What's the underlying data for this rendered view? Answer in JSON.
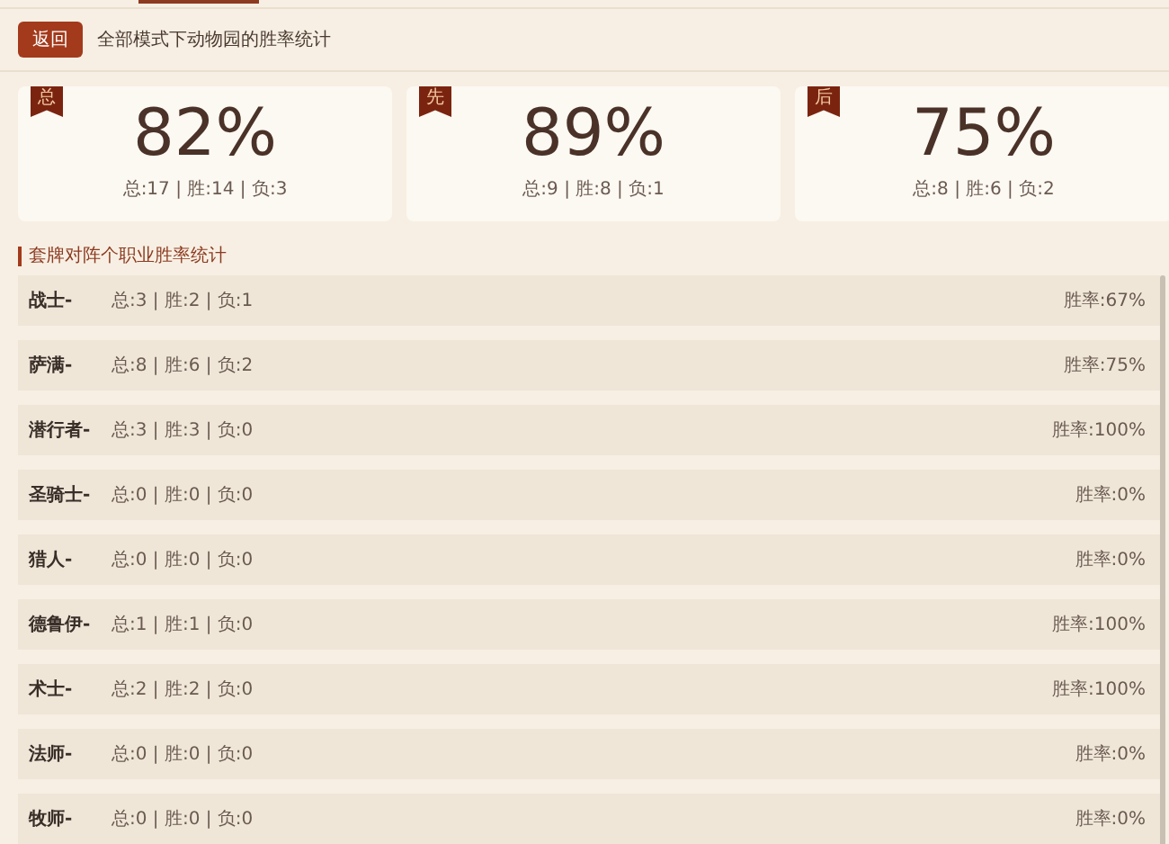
{
  "header": {
    "back_button": "返回",
    "title": "全部模式下动物园的胜率统计"
  },
  "summary_cards": [
    {
      "badge": "总",
      "rate": "82%",
      "detail": "总:17 | 胜:14 | 负:3"
    },
    {
      "badge": "先",
      "rate": "89%",
      "detail": "总:9 | 胜:8 | 负:1"
    },
    {
      "badge": "后",
      "rate": "75%",
      "detail": "总:8 | 胜:6 | 负:2"
    }
  ],
  "section_title": "套牌对阵个职业胜率统计",
  "rows": [
    {
      "class": "战士-",
      "record": "总:3 | 胜:2 | 负:1",
      "win_rate": "胜率:67%"
    },
    {
      "class": "萨满-",
      "record": "总:8 | 胜:6 | 负:2",
      "win_rate": "胜率:75%"
    },
    {
      "class": "潜行者-",
      "record": "总:3 | 胜:3 | 负:0",
      "win_rate": "胜率:100%"
    },
    {
      "class": "圣骑士-",
      "record": "总:0 | 胜:0 | 负:0",
      "win_rate": "胜率:0%"
    },
    {
      "class": "猎人-",
      "record": "总:0 | 胜:0 | 负:0",
      "win_rate": "胜率:0%"
    },
    {
      "class": "德鲁伊-",
      "record": "总:1 | 胜:1 | 负:0",
      "win_rate": "胜率:100%"
    },
    {
      "class": "术士-",
      "record": "总:2 | 胜:2 | 负:0",
      "win_rate": "胜率:100%"
    },
    {
      "class": "法师-",
      "record": "总:0 | 胜:0 | 负:0",
      "win_rate": "胜率:0%"
    },
    {
      "class": "牧师-",
      "record": "总:0 | 胜:0 | 负:0",
      "win_rate": "胜率:0%"
    }
  ]
}
